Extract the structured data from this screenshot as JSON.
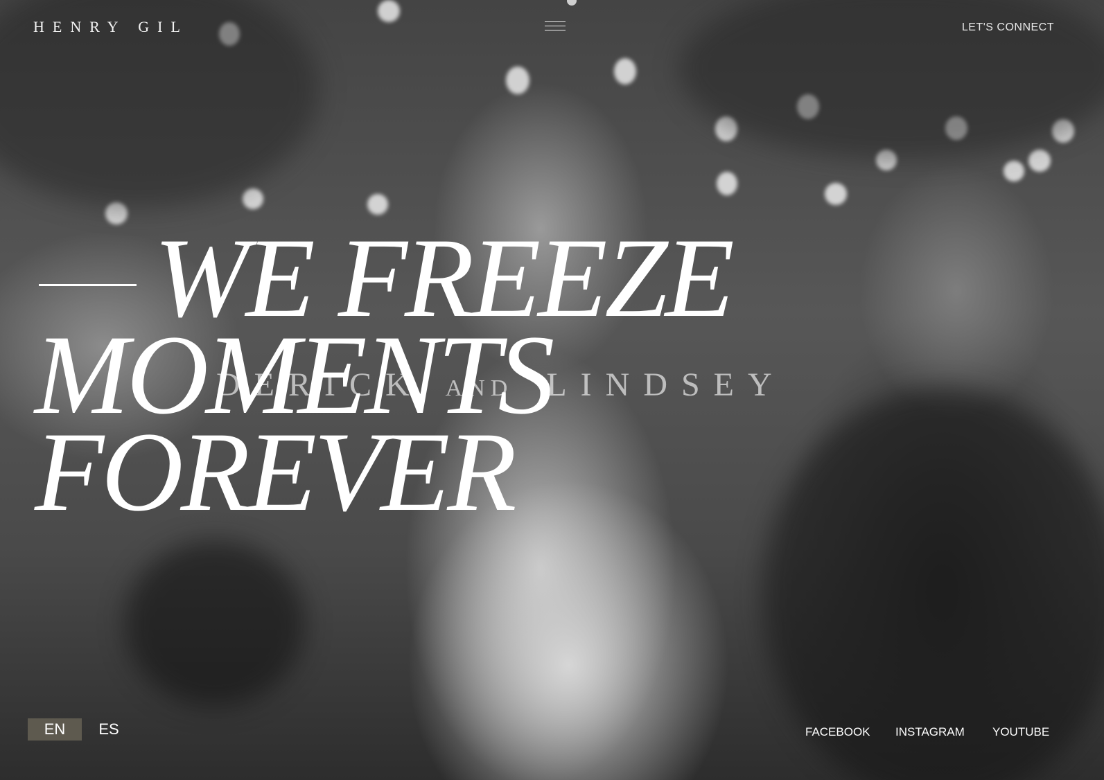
{
  "header": {
    "logo": "HENRY GIL",
    "menu_icon": "hamburger-menu-icon",
    "cta": "LET'S CONNECT"
  },
  "hero": {
    "headline": [
      "WE FREEZE",
      "MOMENTS",
      "FOREVER"
    ],
    "couple": {
      "name1": "DERICK",
      "and": "AND",
      "name2": "LINDSEY"
    }
  },
  "languages": {
    "items": [
      "EN",
      "ES"
    ],
    "active": "EN",
    "active_color": "#5e5a4f"
  },
  "social": {
    "facebook": "FACEBOOK",
    "instagram": "INSTAGRAM",
    "youtube": "YOUTUBE"
  }
}
